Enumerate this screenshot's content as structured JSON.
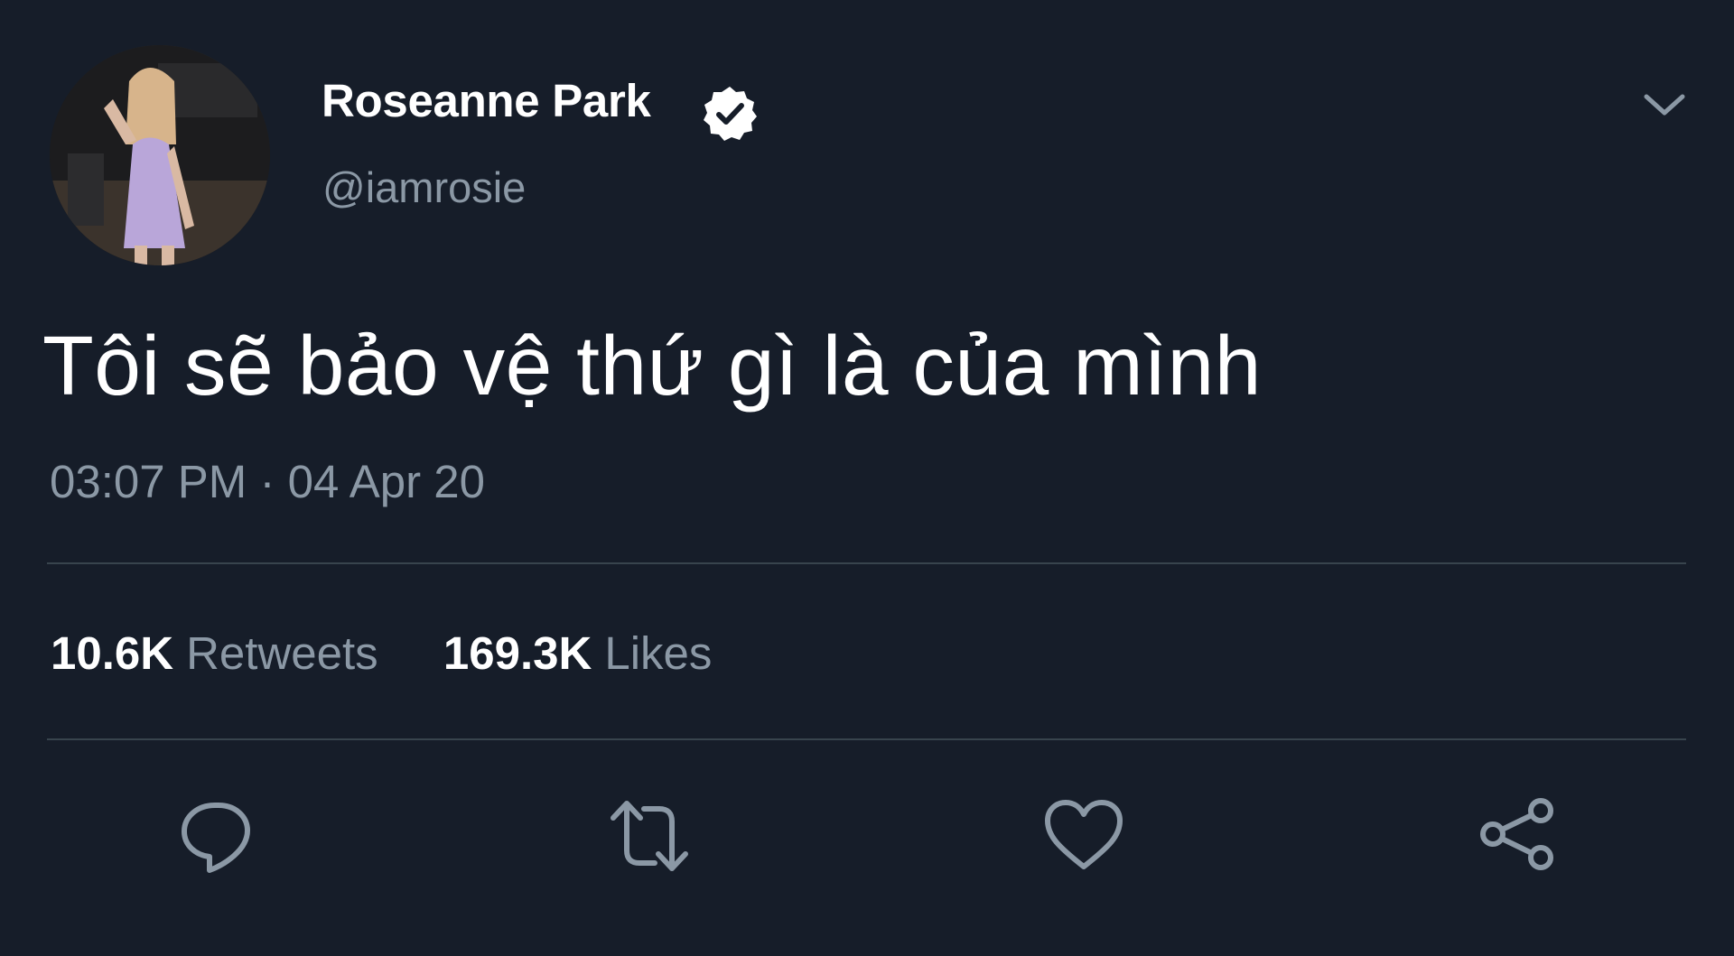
{
  "user": {
    "display_name": "Roseanne Park",
    "handle": "@iamrosie",
    "verified": true
  },
  "tweet": {
    "text": "Tôi sẽ bảo vệ thứ gì là của mình",
    "timestamp": "03:07 PM · 04 Apr 20"
  },
  "stats": {
    "retweets_count": "10.6K",
    "retweets_label": "Retweets",
    "likes_count": "169.3K",
    "likes_label": "Likes"
  },
  "icons": {
    "verified": "verified-badge-icon",
    "menu": "chevron-down-icon",
    "reply": "reply-icon",
    "retweet": "retweet-icon",
    "like": "heart-icon",
    "share": "share-icon"
  },
  "colors": {
    "background": "#161d29",
    "primary_text": "#ffffff",
    "secondary_text": "#8b98a5",
    "divider": "#38444d"
  }
}
